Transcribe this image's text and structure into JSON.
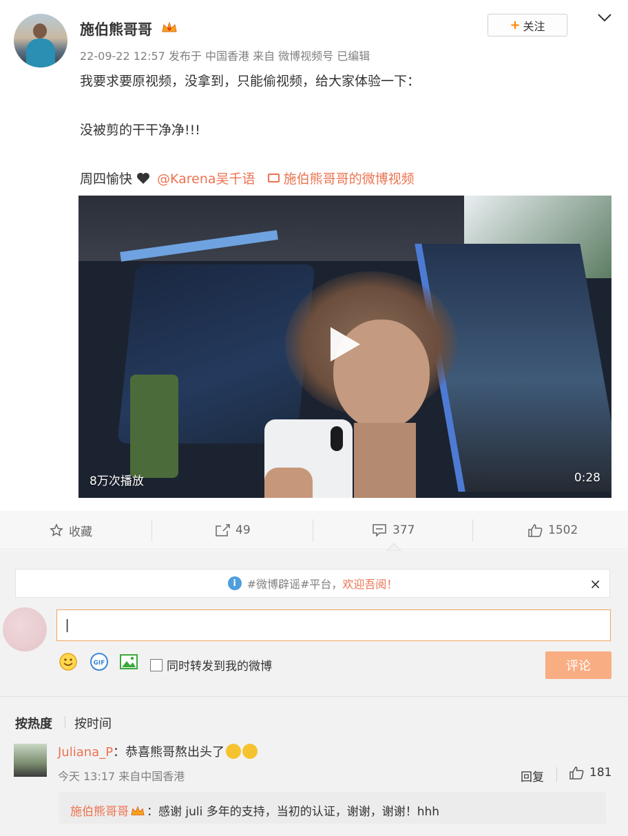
{
  "post": {
    "author": "施伯熊哥哥",
    "meta": "22-09-22 12:57 发布于 中国香港 来自 微博视频号  已编辑",
    "follow_label": "关注",
    "line1": "我要求要原视频，没拿到，只能偷视频，给大家体验一下：",
    "line2": "没被剪的干干净净!!!",
    "line3_prefix": "周四愉快",
    "mention": "@Karena吴千语",
    "video_link": "施伯熊哥哥的微博视频"
  },
  "video": {
    "views": "8万次播放",
    "duration": "0:28"
  },
  "actions": {
    "favorite": "收藏",
    "share_count": "49",
    "comment_count": "377",
    "like_count": "1502"
  },
  "notice": {
    "text": "#微博辟谣#平台，",
    "welcome": "欢迎吾阅！",
    "close": "×"
  },
  "composer": {
    "input_value": "|",
    "sync_label": "同时转发到我的微博",
    "submit_label": "评论"
  },
  "sort": {
    "hot": "按热度",
    "time": "按时间"
  },
  "comment": {
    "user": "Juliana_P",
    "text": "：恭喜熊哥熬出头了",
    "time": "今天 13:17 来自中国香港",
    "reply_label": "回复",
    "likes": "181",
    "reply_user": "施伯熊哥哥",
    "reply_text": "：感谢 juli 多年的支持，当初的认证，谢谢，谢谢！hhh"
  },
  "colors": {
    "accent": "#eb7350",
    "submit": "#f9ad82",
    "input_border": "#f0a25a"
  }
}
